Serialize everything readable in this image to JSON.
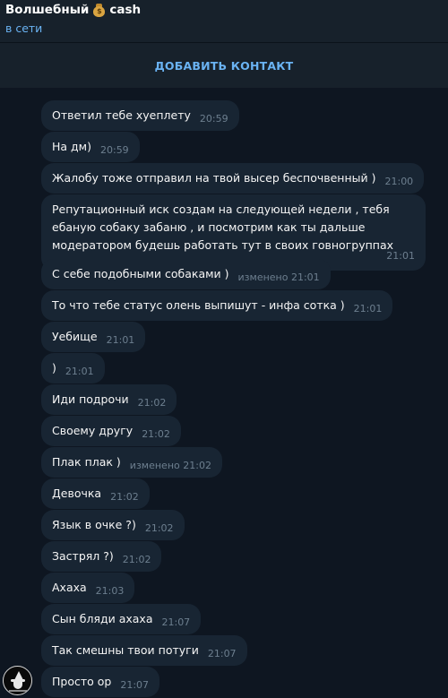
{
  "header": {
    "title_name": "Волшебный",
    "title_icon": "moneybag-icon",
    "title_suffix": "cash",
    "status": "в сети"
  },
  "add_contact_label": "ДОБАВИТЬ КОНТАКТ",
  "messages": [
    {
      "text": "Ответил тебе хуеплету",
      "time": "20:59"
    },
    {
      "text": "На дм)",
      "time": "20:59"
    },
    {
      "text": "Жалобу тоже отправил на твой высер беспочвенный )",
      "time": "21:00"
    },
    {
      "text": "Репутационный иск создам на следующей недели , тебя ебаную собаку забаню , и посмотрим как ты дальше модератором будешь работать тут в своих говногруппах",
      "time": "21:01"
    },
    {
      "text": "С себе подобными собаками )",
      "time": "изменено 21:01"
    },
    {
      "text": "То что тебе статус олень выпишут - инфа сотка )",
      "time": "21:01"
    },
    {
      "text": "Уебище",
      "time": "21:01"
    },
    {
      "text": ")",
      "time": "21:01"
    },
    {
      "text": "Иди подрочи",
      "time": "21:02"
    },
    {
      "text": "Своему другу",
      "time": "21:02"
    },
    {
      "text": "Плак плак )",
      "time": "изменено 21:02"
    },
    {
      "text": "Девочка",
      "time": "21:02"
    },
    {
      "text": "Язык в очке ?)",
      "time": "21:02"
    },
    {
      "text": "Застрял ?)",
      "time": "21:02"
    },
    {
      "text": "Ахаха",
      "time": "21:03"
    },
    {
      "text": "Сын бляди ахаха",
      "time": "21:07"
    },
    {
      "text": "Так смешны твои потуги",
      "time": "21:07"
    },
    {
      "text": "Просто ор",
      "time": "21:07"
    }
  ],
  "colors": {
    "background": "#0e1621",
    "header": "#17212b",
    "bubble": "#182533",
    "accent": "#6ab3f3",
    "timestamp": "#6d7f8f"
  }
}
